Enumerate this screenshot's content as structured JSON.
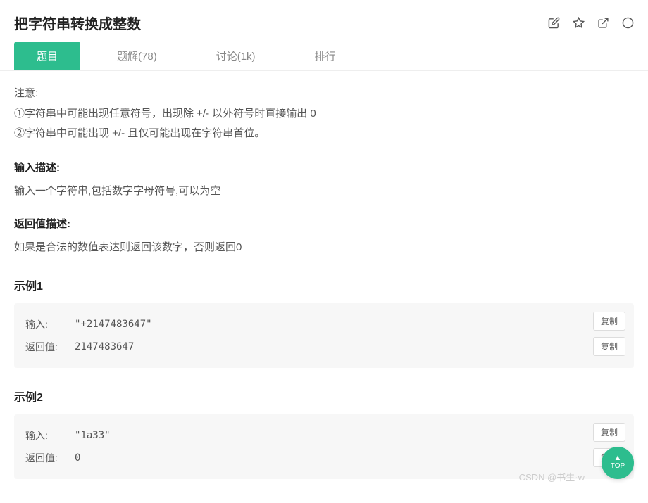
{
  "header": {
    "title": "把字符串转换成整数"
  },
  "tabs": {
    "problem": "题目",
    "solutions": "题解(78)",
    "discuss": "讨论(1k)",
    "rank": "排行"
  },
  "content": {
    "notice_label": "注意:",
    "notice_1": "①字符串中可能出现任意符号，出现除 +/- 以外符号时直接输出 0",
    "notice_2": "②字符串中可能出现 +/- 且仅可能出现在字符串首位。",
    "input_heading": "输入描述:",
    "input_desc": "输入一个字符串,包括数字字母符号,可以为空",
    "return_heading": "返回值描述:",
    "return_desc": "如果是合法的数值表达则返回该数字，否则返回0"
  },
  "examples": [
    {
      "title": "示例1",
      "input_label": "输入:",
      "input_value": "\"+2147483647\"",
      "return_label": "返回值:",
      "return_value": "2147483647",
      "copy_label": "复制"
    },
    {
      "title": "示例2",
      "input_label": "输入:",
      "input_value": "\"1a33\"",
      "return_label": "返回值:",
      "return_value": "0",
      "copy_label": "复制"
    }
  ],
  "watermark": "CSDN @书生·w",
  "top_label": "TOP"
}
